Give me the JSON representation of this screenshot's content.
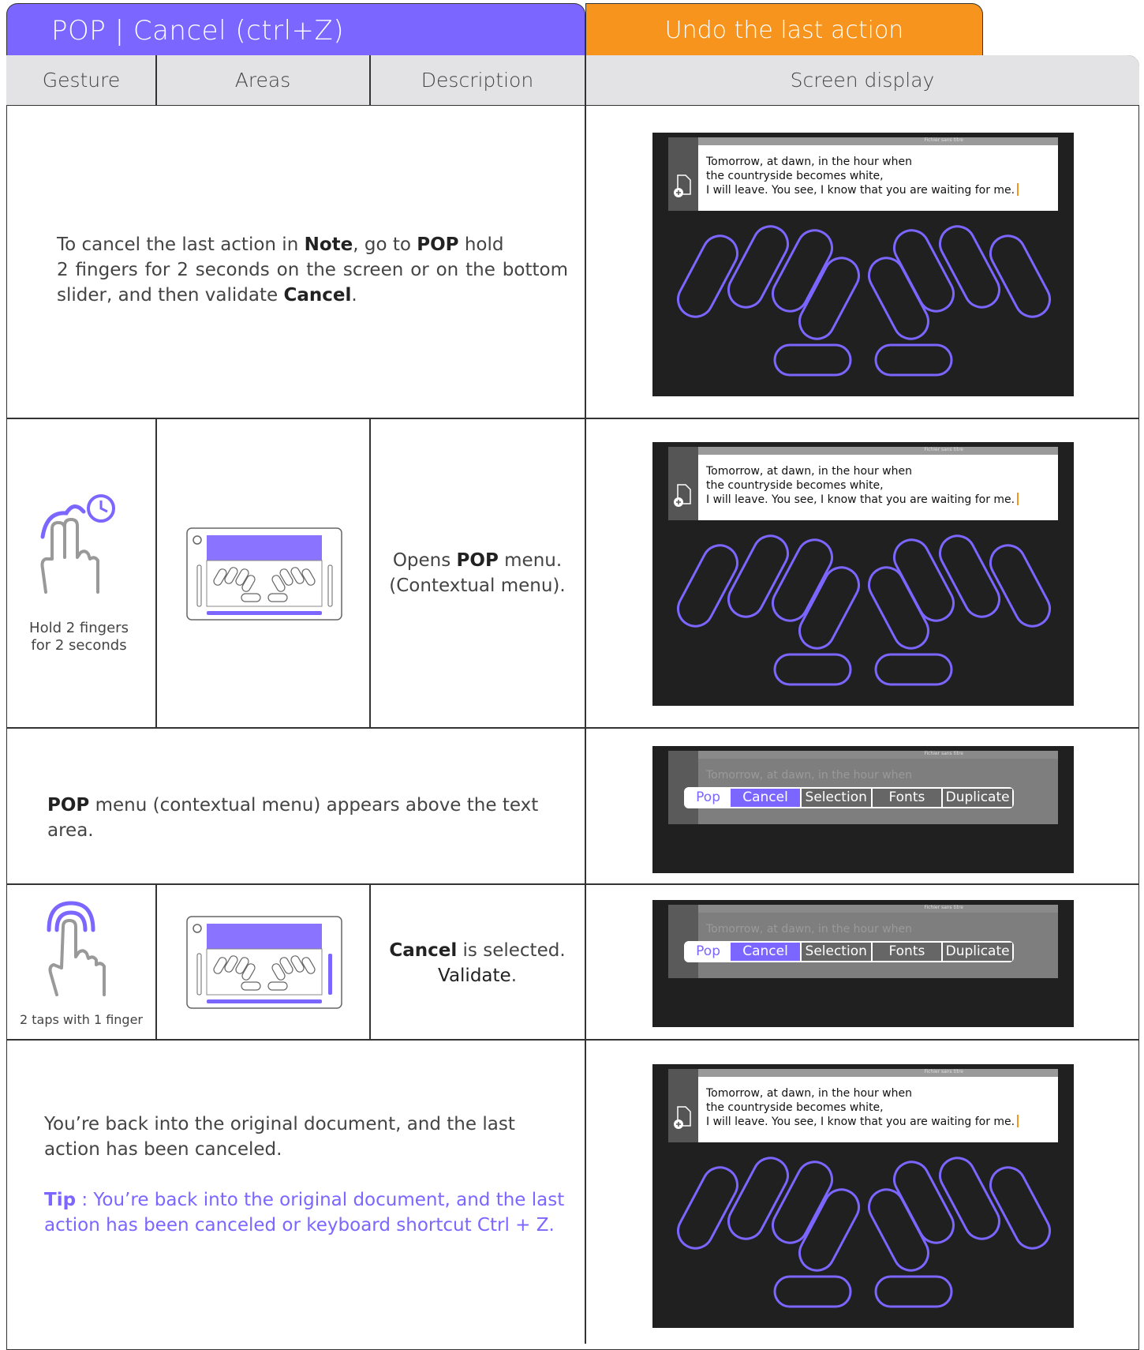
{
  "header": {
    "title": "POP | Cancel (ctrl+Z)",
    "subtitle": "Undo the last action"
  },
  "columns": [
    "Gesture",
    "Areas",
    "Description",
    "Screen display"
  ],
  "rows": {
    "r1": {
      "pre1": "To cancel the last action in ",
      "note": "Note",
      "pre2": ", go to ",
      "pop": "POP",
      "post1": " hold",
      "line2": "2 fingers for 2 seconds on the screen or on the bottom",
      "line3a": "slider, and then validate ",
      "cancel": "Cancel",
      "line3b": "."
    },
    "r2": {
      "gesture_label": "Hold 2 fingers for 2 seconds",
      "d1a": "Opens ",
      "d1b": "POP",
      "d1c": " menu.",
      "d2": "(Contextual menu)."
    },
    "r3": {
      "pop": "POP",
      "rest": " menu (contextual menu) appears above the text area."
    },
    "r4": {
      "gesture_label": "2 taps with 1 finger",
      "cancel": "Cancel",
      "is_selected": " is selected.",
      "validate": "Validate",
      "period": "."
    },
    "r5": {
      "p1": "You’re back into the original document, and the last action has been canceled.",
      "tip": "Tip",
      "tip_text": " : You’re back into the original document, and the last action has been canceled or keyboard shortcut Ctrl + Z."
    }
  },
  "screen": {
    "file_label": "Fichier sans titre",
    "line1": "Tomorrow, at dawn, in the hour when",
    "line2": "the countryside becomes white,",
    "line3": "I will leave. You see, I know that you are waiting for me.",
    "menu": [
      "Pop",
      "Cancel",
      "Selection",
      "Fonts",
      "Duplicate"
    ]
  },
  "colors": {
    "accent": "#7b66ff",
    "orange": "#f7941d",
    "header_bg": "#e3e3e5",
    "screen_bg": "#202020"
  }
}
